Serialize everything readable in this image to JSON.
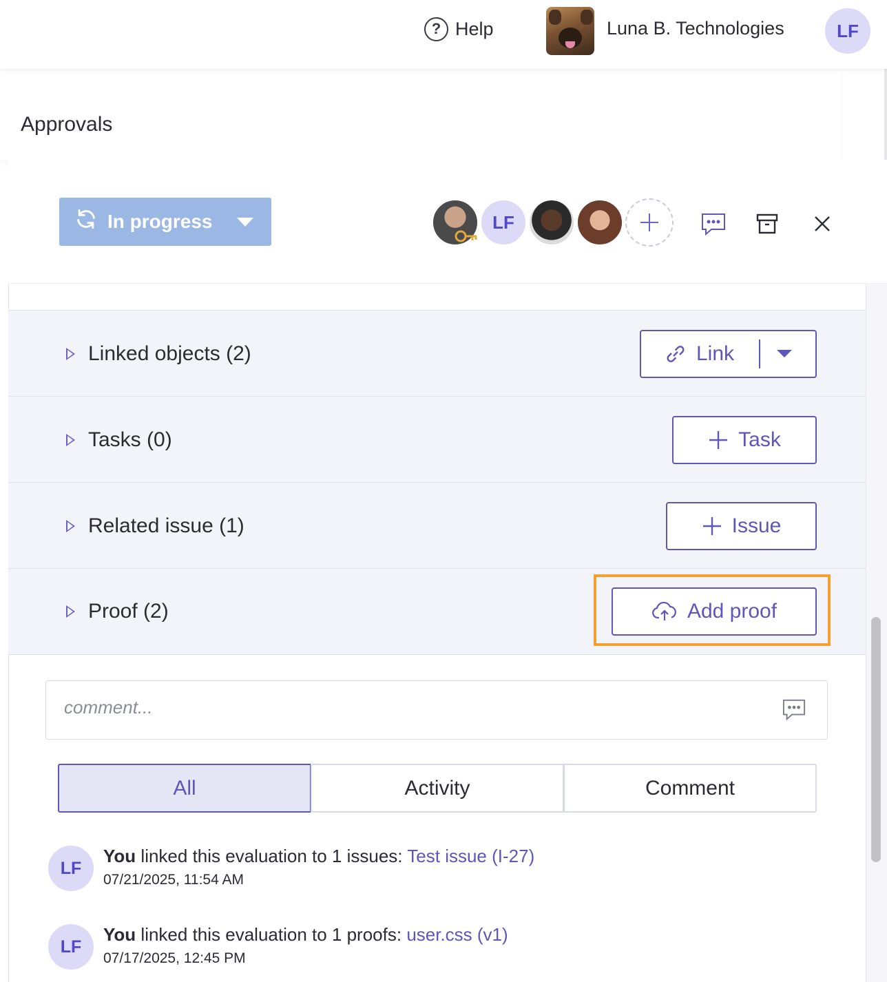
{
  "topbar": {
    "help_label": "Help",
    "org_name": "Luna B. Technologies",
    "user_initials": "LF"
  },
  "page": {
    "title": "Approvals"
  },
  "panel": {
    "status": {
      "label": "In progress",
      "color": "#9bb8e4"
    },
    "watchers": {
      "avatar_initials": "LF"
    }
  },
  "sections": {
    "linked_objects": {
      "label": "Linked objects (2)",
      "button": "Link"
    },
    "tasks": {
      "label": "Tasks (0)",
      "button": "Task"
    },
    "related_issue": {
      "label": "Related issue (1)",
      "button": "Issue"
    },
    "proof": {
      "label": "Proof (2)",
      "button": "Add proof"
    }
  },
  "comment": {
    "placeholder": "comment..."
  },
  "tabs": [
    {
      "label": "All",
      "active": true
    },
    {
      "label": "Activity",
      "active": false
    },
    {
      "label": "Comment",
      "active": false
    }
  ],
  "activity": [
    {
      "initials": "LF",
      "actor": "You",
      "text": " linked this evaluation to 1 issues: ",
      "link": "Test issue (I-27)",
      "time": "07/21/2025, 11:54 AM"
    },
    {
      "initials": "LF",
      "actor": "You",
      "text": " linked this evaluation to 1 proofs: ",
      "link": "user.css (v1)",
      "time": "07/17/2025, 12:45 PM"
    }
  ],
  "colors": {
    "accent": "#5e56b8",
    "highlight": "#f5a033",
    "avatar_bg": "#dcdaf7"
  }
}
